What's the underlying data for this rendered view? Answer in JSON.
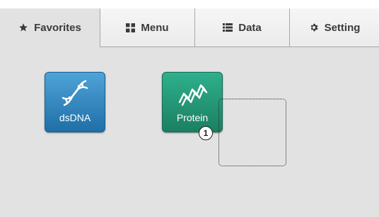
{
  "tabs": [
    {
      "label": "Favorites",
      "icon": "star-icon",
      "active": true
    },
    {
      "label": "Menu",
      "icon": "grid-icon",
      "active": false
    },
    {
      "label": "Data",
      "icon": "list-icon",
      "active": false
    },
    {
      "label": "Setting",
      "icon": "gear-icon",
      "active": false
    }
  ],
  "tiles": [
    {
      "label": "dsDNA",
      "icon": "dna-helix-icon",
      "color": "#2f86c2"
    },
    {
      "label": "Protein",
      "icon": "protein-icon",
      "color": "#25997a"
    }
  ],
  "step_badge": "1"
}
